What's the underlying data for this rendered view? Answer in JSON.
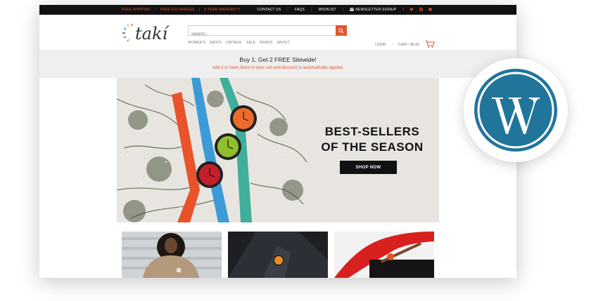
{
  "topbar": {
    "promos": [
      "FREE SHIPPING",
      "FREE EXCHANGES",
      "5-YEAR WARRANTY"
    ],
    "links": [
      "CONTACT US",
      "FAQS",
      "WISHLIST",
      "NEWSLETTER SIGNUP"
    ]
  },
  "header": {
    "logo": "takí",
    "search_placeholder": "Search...",
    "nav": [
      "WOMEN'S",
      "MEN'S",
      "VINTAGE",
      "SALE",
      "BANDS",
      "ABOUT"
    ],
    "login": "LOGIN",
    "cart": "CART / $0.00"
  },
  "promo": {
    "headline": "Buy 1, Get 2 FREE Sitewide!",
    "subline": "Add 3 or more items to your cart and discount is automatically applied."
  },
  "hero": {
    "title_line1": "BEST-SELLERS",
    "title_line2": "OF THE SEASON",
    "button": "SHOP NOW"
  },
  "colors": {
    "accent": "#e2572e",
    "topbar": "#111111",
    "wordpress_blue": "#21759b"
  },
  "icons": [
    "facebook-icon",
    "twitter-icon",
    "instagram-icon",
    "pinterest-icon",
    "search-icon",
    "cart-icon",
    "envelope-icon",
    "wordpress-logo-icon"
  ]
}
